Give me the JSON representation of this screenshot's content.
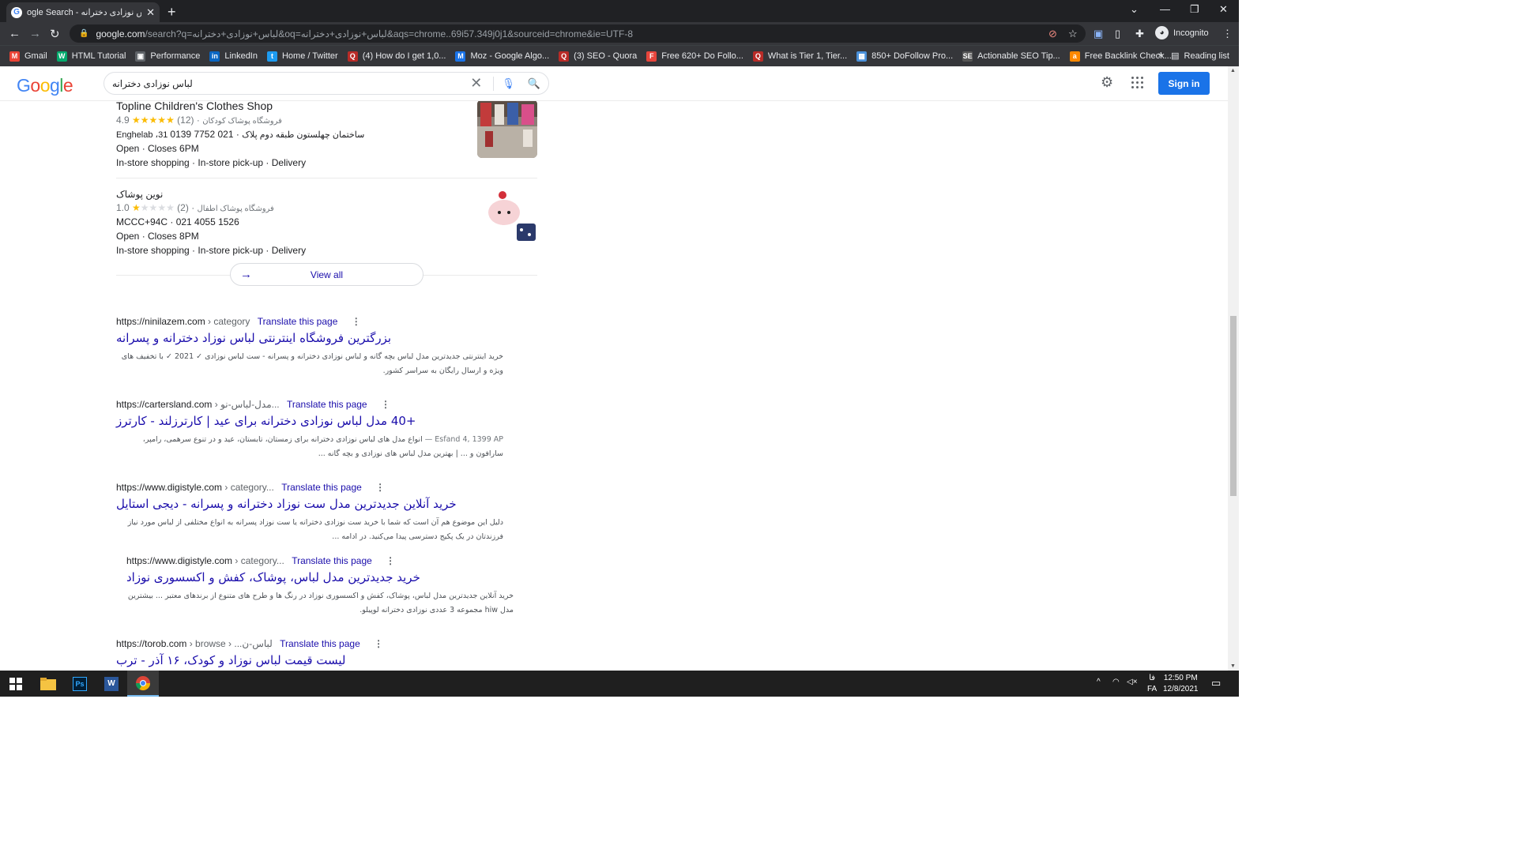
{
  "browser": {
    "tab_title": "ogle Search - لباس نوزادی دخترانه",
    "tab_close": "✕",
    "new_tab": "+",
    "url_host": "google.com",
    "url_path": "/search?q=لباس+نوزادی+دخترانه&oq=لباس+نوزادی+دخترانه&aqs=chrome..69i57.349j0j1&sourceid=chrome&ie=UTF-8",
    "incognito_label": "Incognito",
    "bookmarks": [
      {
        "label": "Gmail",
        "icon": "gmail-icon",
        "color": "#ea4335",
        "glyph": "M"
      },
      {
        "label": "HTML Tutorial",
        "icon": "w3schools-icon",
        "color": "#04aa6d",
        "glyph": "W"
      },
      {
        "label": "Performance",
        "icon": "performance-icon",
        "color": "#5f6368",
        "glyph": "▣"
      },
      {
        "label": "LinkedIn",
        "icon": "linkedin-icon",
        "color": "#0a66c2",
        "glyph": "in"
      },
      {
        "label": "Home / Twitter",
        "icon": "twitter-icon",
        "color": "#1d9bf0",
        "glyph": "t"
      },
      {
        "label": "(4) How do I get 1,0...",
        "icon": "quora-icon",
        "color": "#b92b27",
        "glyph": "Q"
      },
      {
        "label": "Moz - Google Algo...",
        "icon": "moz-icon",
        "color": "#1a73e8",
        "glyph": "M"
      },
      {
        "label": "(3) SEO - Quora",
        "icon": "quora-icon",
        "color": "#b92b27",
        "glyph": "Q"
      },
      {
        "label": "Free 620+ Do Follo...",
        "icon": "site-icon",
        "color": "#e8453c",
        "glyph": "F"
      },
      {
        "label": "What is Tier 1, Tier...",
        "icon": "quora-icon",
        "color": "#b92b27",
        "glyph": "Q"
      },
      {
        "label": "850+ DoFollow Pro...",
        "icon": "site-icon",
        "color": "#4a90d9",
        "glyph": "▦"
      },
      {
        "label": "Actionable SEO Tip...",
        "icon": "seo-icon",
        "color": "#555555",
        "glyph": "SE"
      },
      {
        "label": "Free Backlink Check...",
        "icon": "ahrefs-icon",
        "color": "#ff8800",
        "glyph": "a"
      }
    ],
    "bookmarks_more": "»",
    "reading_list": "Reading list"
  },
  "google": {
    "logo": [
      "G",
      "o",
      "o",
      "g",
      "l",
      "e"
    ],
    "logo_colors": [
      "#4285f4",
      "#ea4335",
      "#fbbc05",
      "#4285f4",
      "#34a853",
      "#ea4335"
    ],
    "query": "لباس نوزادی دخترانه",
    "sign_in": "Sign in"
  },
  "local_pack": {
    "places": [
      {
        "name": "Topline Children's Clothes Shop",
        "rating": "4.9",
        "stars_filled": 5,
        "reviews": "(12)",
        "category": "فروشگاه پوشاک کودکان",
        "address": "Enghelab ،31 ساختمان چهلستون طبقه دوم پلاک",
        "phone": "021 7752 0139",
        "hours": "Open · Closes 6PM",
        "services": "In-store shopping · In-store pick-up · Delivery"
      },
      {
        "name": "نوین پوشاک",
        "rating": "1.0",
        "stars_filled": 1,
        "reviews": "(2)",
        "category": "فروشگاه پوشاک اطفال",
        "address": "MCCC+94C",
        "phone": "021 4055 1526",
        "hours": "Open · Closes 8PM",
        "services": "In-store shopping · In-store pick-up · Delivery"
      }
    ],
    "view_all": "View all"
  },
  "results": [
    {
      "domain": "https://ninilazem.com",
      "path": " › category",
      "translate": "Translate this page",
      "title": "بزرگترین فروشگاه اینترنتی لباس نوزاد دخترانه و پسرانه",
      "date": "",
      "snippet": "خرید اینترنتی جدیدترین مدل لباس بچه گانه و لباس نوزادی دخترانه و پسرانه - ست لباس نوزادی ✓ 2021 ✓ با تخفیف های ویژه و ارسال رایگان به سراسر کشور."
    },
    {
      "domain": "https://cartersland.com",
      "path": " › مدل-لباس-نو...",
      "translate": "Translate this page",
      "title": "+40 مدل لباس نوزادی دخترانه برای عید | کارترزلند - کارترز",
      "date": "Esfand 4, 1399 AP — ",
      "snippet": "انواع مدل های لباس نوزادی دخترانه برای زمستان، تابستان، عید و در تنوع سرهمی، رامپر، سارافون و ... | بهترین مدل لباس های نوزادی و بچه گانه ..."
    },
    {
      "domain": "https://www.digistyle.com",
      "path": " › category...",
      "translate": "Translate this page",
      "title": "خرید آنلاین جدیدترین مدل ست نوزاد دخترانه و پسرانه - دیجی استایل",
      "date": "",
      "snippet": "دلیل این موضوع هم آن است که شما با خرید ست نوزادی دخترانه یا ست نوزاد پسرانه به انواع مختلفی از لباس مورد نیاز فرزندتان در یک پکیج دسترسی پیدا می‌کنید. در ادامه ..."
    },
    {
      "domain": "https://www.digistyle.com",
      "path": " › category...",
      "translate": "Translate this page",
      "title": "خرید جدیدترین مدل لباس، پوشاک، کفش و اکسسوری نوزاد",
      "date": "",
      "snippet": "خرید آنلاین جدیدترین مدل لباس، پوشاک، کفش و اکسسوری نوزاد در رنگ ها و طرح های متنوع از برندهای معتبر ... بیشترین مدل hiw مجموعه 3 عددی نوزادی دخترانه لوپیلو."
    },
    {
      "domain": "https://torob.com",
      "path": " › browse › ...لباس-ن",
      "translate": "Translate this page",
      "title": "لیست قیمت لباس نوزاد و کودک، ۱۶ آذر - ترب",
      "date": "",
      "snippet": ""
    }
  ],
  "taskbar": {
    "time": "12:50 PM",
    "date": "12/8/2021",
    "lang_top": "فا",
    "lang_bottom": "FA"
  }
}
